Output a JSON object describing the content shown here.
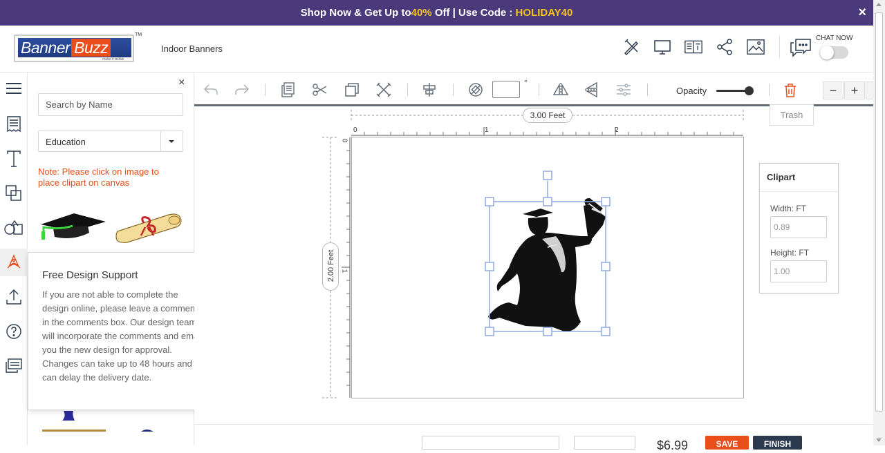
{
  "promo": {
    "prefix": "Shop Now & Get Up to ",
    "percent": "40%",
    "middle": " Off | Use Code : ",
    "code": "HOLIDAY40",
    "close": "×"
  },
  "header": {
    "logo_word1": "Banner",
    "logo_word2": "Buzz",
    "logo_tag": "make it visible",
    "logo_tm": "TM",
    "breadcrumb": "Indoor Banners",
    "chat_label": "CHAT NOW"
  },
  "panel": {
    "close": "×",
    "search_placeholder": "Search by Name",
    "category": "Education",
    "note": "Note: Please click on image to place clipart on canvas"
  },
  "popup": {
    "close": "×",
    "title": "Free Design Support",
    "body": "If you are not able to complete the design online, please leave a comments in the comments box. Our design team will incorporate the comments and email you the new design for approval. Changes can take up to 48 hours and can delay the delivery date."
  },
  "toolbar": {
    "degree_symbol": "°",
    "opacity_label": "Opacity",
    "trash_tooltip": "Trash",
    "zoom_out": "−",
    "zoom_in": "+"
  },
  "canvas": {
    "width_label": "3.00 Feet",
    "height_label": "2.00 Feet",
    "ruler_x": [
      "0",
      "1",
      "2"
    ],
    "ruler_y": [
      "0",
      "1"
    ]
  },
  "properties": {
    "title": "Clipart",
    "width_label": "Width:",
    "width_unit": "FT",
    "width_value": "0.89",
    "height_label": "Height:",
    "height_unit": "FT",
    "height_value": "1.00"
  },
  "footer": {
    "price": "$6.99",
    "save": "SAVE",
    "finish": "FINISH"
  },
  "colors": {
    "promo_bg": "#4a3a7c",
    "accent_orange": "#e94e1b",
    "highlight_yellow": "#f5c518",
    "selection_blue": "#8fa8e0"
  },
  "icons": [
    "close-icon",
    "design-tools-icon",
    "desktop-preview-icon",
    "book-view-icon",
    "share-icon",
    "image-icon",
    "chat-icon",
    "menu-icon",
    "template-icon",
    "text-icon",
    "layers-icon",
    "shapes-icon",
    "clipart-icon",
    "upload-icon",
    "help-icon",
    "comments-icon",
    "undo-icon",
    "redo-icon",
    "paste-icon",
    "cut-icon",
    "copy-icon",
    "delete-x-icon",
    "align-icon",
    "rotate-icon",
    "flip-horizontal-icon",
    "flip-vertical-icon",
    "adjust-icon",
    "trash-icon"
  ]
}
